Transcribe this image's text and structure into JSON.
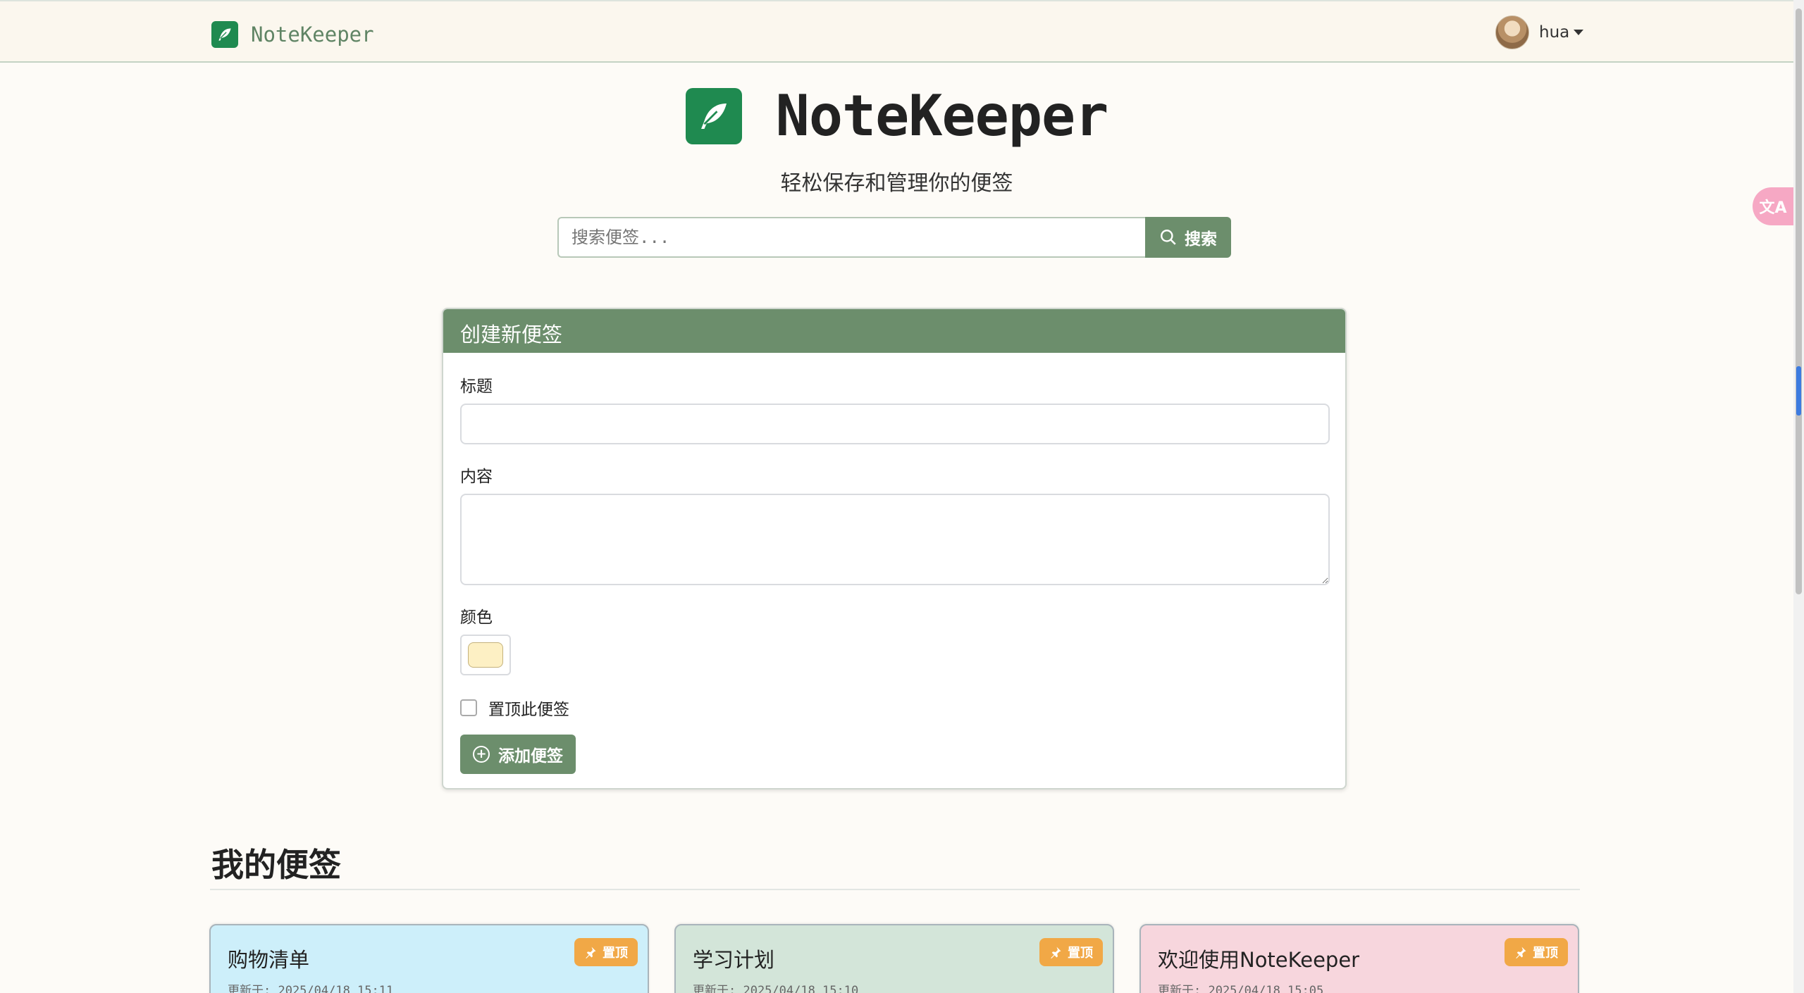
{
  "navbar": {
    "brand": "NoteKeeper",
    "username": "hua"
  },
  "hero": {
    "title": "NoteKeeper",
    "subtitle": "轻松保存和管理你的便签"
  },
  "search": {
    "placeholder": "搜索便签...",
    "button_label": "搜索"
  },
  "create_form": {
    "header": "创建新便签",
    "title_label": "标题",
    "title_value": "",
    "content_label": "内容",
    "content_value": "",
    "color_label": "颜色",
    "color_value": "#fdf0c4",
    "pin_label": "置顶此便签",
    "pin_checked": false,
    "submit_label": "添加便签"
  },
  "notes_section": {
    "title": "我的便签"
  },
  "notes": [
    {
      "title": "购物清单",
      "updated": "更新于: 2025/04/18 15:11",
      "badge": "置顶",
      "color": "#cdeffa"
    },
    {
      "title": "学习计划",
      "updated": "更新于: 2025/04/18 15:10",
      "badge": "置顶",
      "color": "#d3e5d9"
    },
    {
      "title": "欢迎使用NoteKeeper",
      "updated": "更新于: 2025/04/18 15:05",
      "badge": "置顶",
      "color": "#f7d6dd"
    }
  ],
  "colors": {
    "accent": "#6c8e6c",
    "brand_green": "#1f8a50",
    "pin_badge": "#f1a846"
  }
}
